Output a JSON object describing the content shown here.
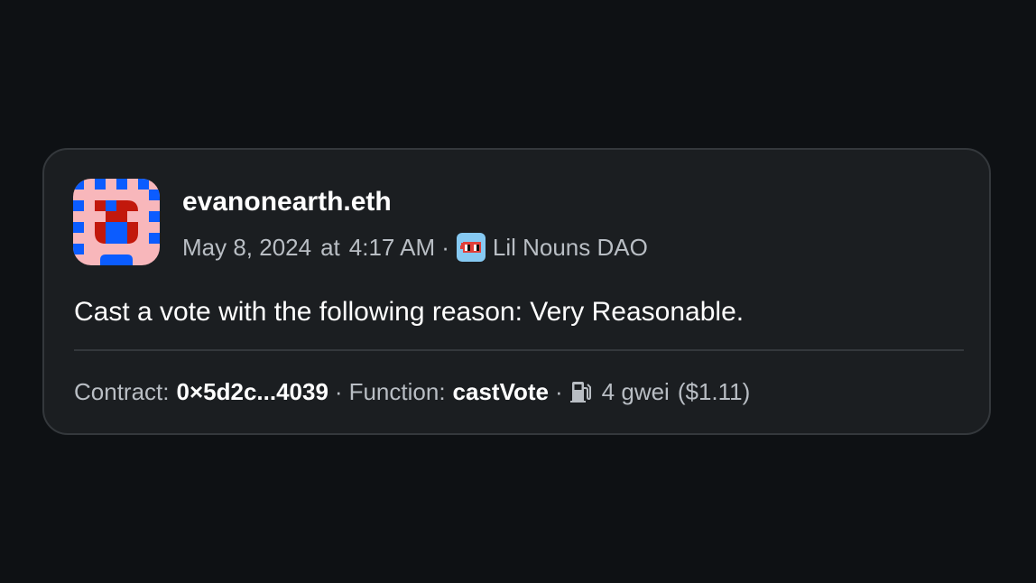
{
  "post": {
    "author": "evanonearth.eth",
    "date": "May 8, 2024",
    "at": "at",
    "time": "4:17 AM",
    "dao_name": "Lil Nouns DAO",
    "body": "Cast a vote with the following reason: Very Reasonable."
  },
  "transaction": {
    "contract_label": "Contract:",
    "contract_value": "0×5d2c...4039",
    "function_label": "Function:",
    "function_value": "castVote",
    "gas": "4 gwei",
    "gas_usd": "($1.11)"
  },
  "icons": {
    "avatar": "noun-avatar",
    "dao": "lil-nouns-dao-icon",
    "gas": "gas-pump-icon"
  },
  "colors": {
    "background": "#0e1114",
    "card": "#1b1e21",
    "avatar_pink": "#f8b7bb",
    "avatar_blue": "#0b5cff",
    "avatar_red": "#c2180c",
    "dao_blue": "#86c9f2"
  }
}
